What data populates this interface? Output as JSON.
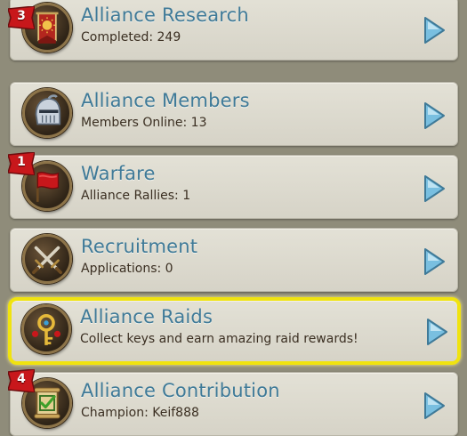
{
  "alliance_menu": {
    "items": [
      {
        "title": "Alliance Research",
        "subtitle": "Completed: 249",
        "badge": "3",
        "icon": "research-banner-icon"
      },
      {
        "title": "Alliance Members",
        "subtitle": "Members Online: 13",
        "badge": null,
        "icon": "knight-helmet-icon"
      },
      {
        "title": "Warfare",
        "subtitle": "Alliance Rallies: 1",
        "badge": "1",
        "icon": "war-flag-icon"
      },
      {
        "title": "Recruitment",
        "subtitle": "Applications: 0",
        "badge": null,
        "icon": "crossed-swords-icon"
      },
      {
        "title": "Alliance Raids",
        "subtitle": "Collect keys and earn amazing raid rewards!",
        "badge": null,
        "icon": "raid-key-icon",
        "highlighted": true
      },
      {
        "title": "Alliance Contribution",
        "subtitle": "Champion: Keif888",
        "badge": "4",
        "icon": "scroll-checkmark-icon"
      }
    ]
  },
  "colors": {
    "title_text": "#3f7a98",
    "highlight_border": "#f0e30f",
    "badge_red": "#c8171b",
    "arrow_blue": "#79bfe0"
  }
}
